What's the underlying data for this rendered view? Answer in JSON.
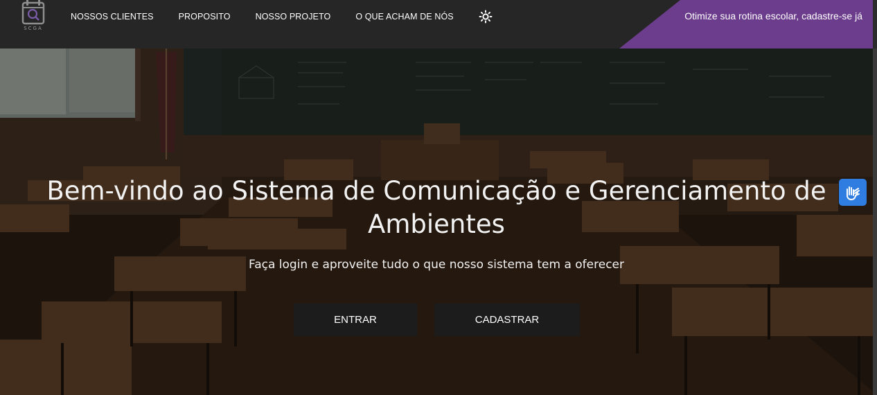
{
  "navbar": {
    "logo_text": "SCGA",
    "links": [
      "NOSSOS CLIENTES",
      "PROPOSITO",
      "NOSSO PROJETO",
      "O QUE ACHAM DE NÓS"
    ],
    "theme_icon": "sun-icon",
    "cta": "Otimize sua rotina escolar, cadastre-se já"
  },
  "hero": {
    "title": "Bem-vindo ao Sistema de Comunicação e Gerenciamento de Ambientes",
    "subtitle": "Faça login e aproveite tudo o que nosso sistema tem a oferecer",
    "buttons": {
      "login": "ENTRAR",
      "signup": "CADASTRAR"
    },
    "background": "classroom-photo"
  },
  "accessibility": {
    "icon": "sign-language-hands-icon"
  },
  "colors": {
    "navbar_bg": "#262626",
    "cta_bg": "#6d3d8d",
    "button_bg": "#1c1c1c",
    "widget_bg": "#2f7de1"
  }
}
